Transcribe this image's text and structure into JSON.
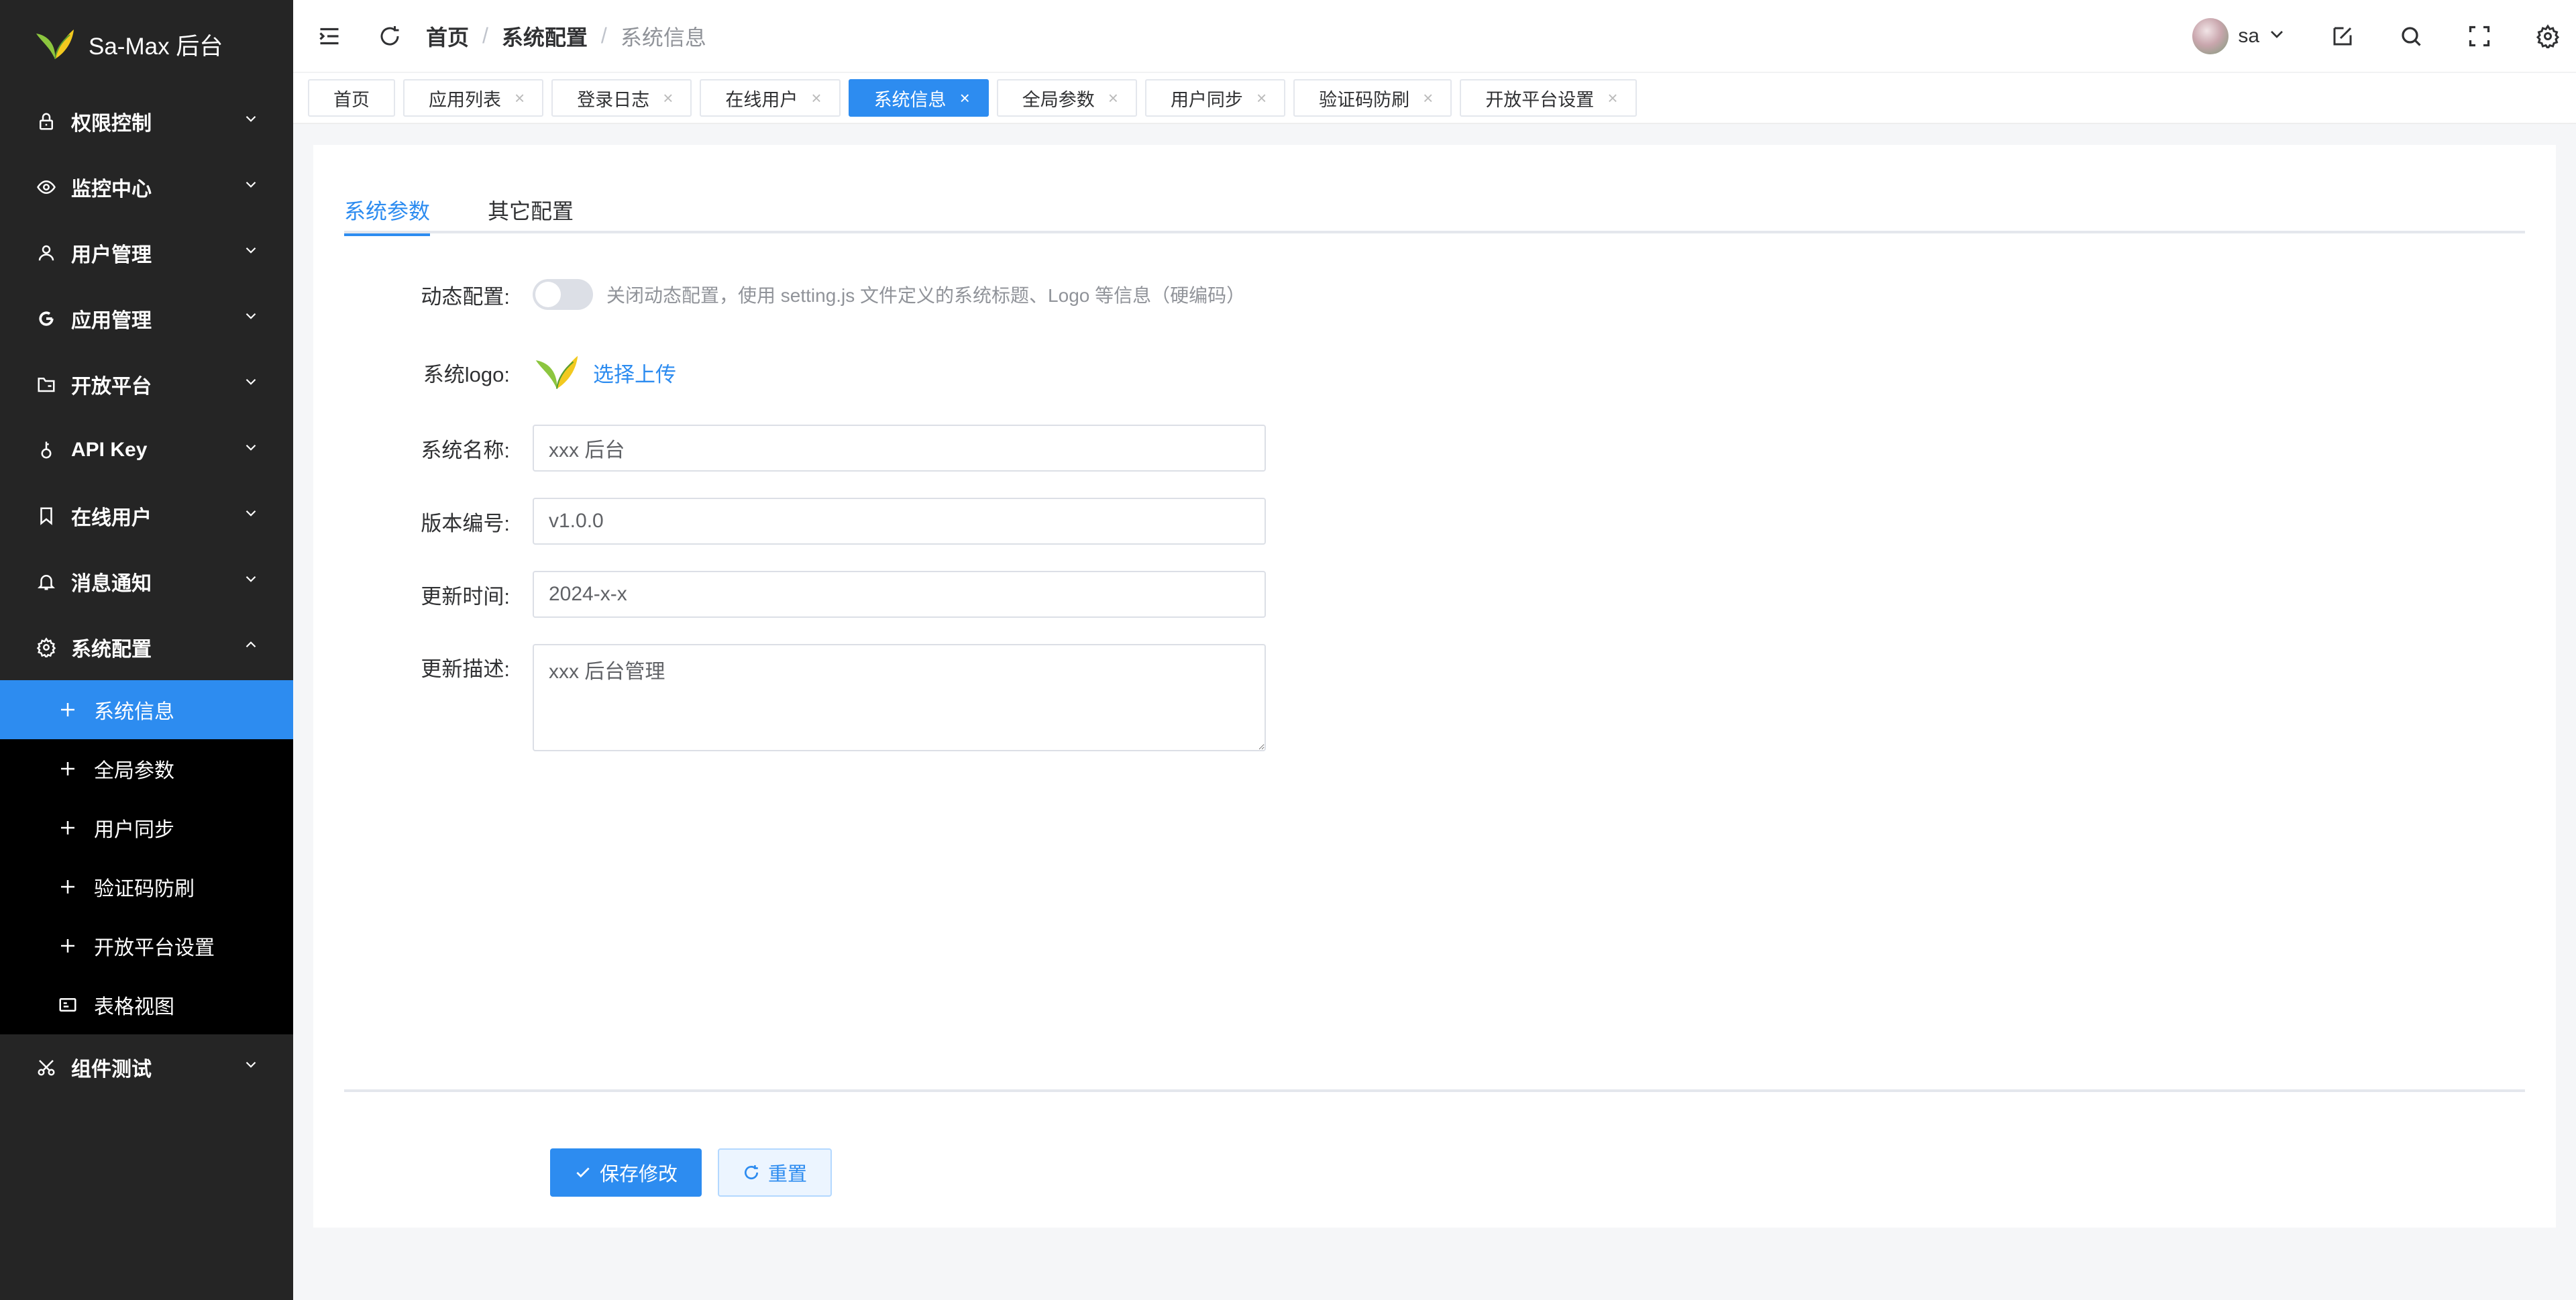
{
  "app": {
    "title": "Sa-Max 后台"
  },
  "sidebar": {
    "items": [
      {
        "label": "权限控制",
        "icon": "lock-icon"
      },
      {
        "label": "监控中心",
        "icon": "eye-icon"
      },
      {
        "label": "用户管理",
        "icon": "user-icon"
      },
      {
        "label": "应用管理",
        "icon": "app-icon"
      },
      {
        "label": "开放平台",
        "icon": "folder-icon"
      },
      {
        "label": "API Key",
        "icon": "key-icon"
      },
      {
        "label": "在线用户",
        "icon": "bookmark-icon"
      },
      {
        "label": "消息通知",
        "icon": "bell-icon"
      },
      {
        "label": "系统配置",
        "icon": "gear-icon"
      }
    ],
    "sub_items": [
      {
        "label": "系统信息",
        "icon": "plus-icon"
      },
      {
        "label": "全局参数",
        "icon": "plus-icon"
      },
      {
        "label": "用户同步",
        "icon": "plus-icon"
      },
      {
        "label": "验证码防刷",
        "icon": "plus-icon"
      },
      {
        "label": "开放平台设置",
        "icon": "plus-icon"
      },
      {
        "label": "表格视图",
        "icon": "table-view-icon"
      }
    ],
    "last_item": {
      "label": "组件测试",
      "icon": "scissors-icon"
    },
    "active_color": "#2d8cf0"
  },
  "header": {
    "breadcrumb": [
      "首页",
      "系统配置",
      "系统信息"
    ],
    "separator": "/",
    "username": "sa"
  },
  "tabs": [
    {
      "label": "首页"
    },
    {
      "label": "应用列表"
    },
    {
      "label": "登录日志"
    },
    {
      "label": "在线用户"
    },
    {
      "label": "系统信息"
    },
    {
      "label": "全局参数"
    },
    {
      "label": "用户同步"
    },
    {
      "label": "验证码防刷"
    },
    {
      "label": "开放平台设置"
    }
  ],
  "tab_close_glyph": "×",
  "content": {
    "tabs": [
      "系统参数",
      "其它配置"
    ],
    "form": {
      "dynamic_label": "动态配置:",
      "dynamic_desc": "关闭动态配置，使用 setting.js 文件定义的系统标题、Logo 等信息（硬编码）",
      "logo_label": "系统logo:",
      "upload_text": "选择上传",
      "name_label": "系统名称:",
      "name_value": "xxx 后台",
      "version_label": "版本编号:",
      "version_value": "v1.0.0",
      "time_label": "更新时间:",
      "time_value": "2024-x-x",
      "desc_label": "更新描述:",
      "desc_value": "xxx 后台管理"
    },
    "buttons": {
      "save": "保存修改",
      "reset": "重置"
    }
  }
}
